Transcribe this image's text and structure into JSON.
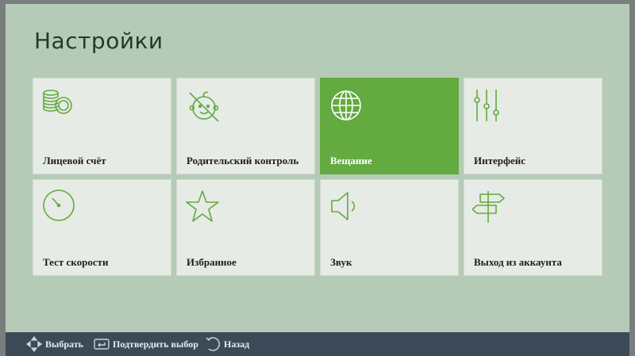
{
  "page": {
    "title": "Настройки"
  },
  "accent_color": "#63aa40",
  "tiles": [
    {
      "label": "Лицевой счёт",
      "icon": "coins-icon"
    },
    {
      "label": "Родительский контроль",
      "icon": "child-lock-icon"
    },
    {
      "label": "Вещание",
      "icon": "globe-icon",
      "selected": true
    },
    {
      "label": "Интерфейс",
      "icon": "sliders-icon"
    },
    {
      "label": "Тест скорости",
      "icon": "speedometer-icon"
    },
    {
      "label": "Избранное",
      "icon": "star-icon"
    },
    {
      "label": "Звук",
      "icon": "speaker-icon"
    },
    {
      "label": "Выход из аккаунта",
      "icon": "signpost-icon"
    }
  ],
  "footer": {
    "hints": [
      {
        "label": "Выбрать",
        "icon": "dpad-icon"
      },
      {
        "label": "Подтвердить выбор",
        "icon": "enter-icon"
      },
      {
        "label": "Назад",
        "icon": "back-icon"
      }
    ]
  }
}
